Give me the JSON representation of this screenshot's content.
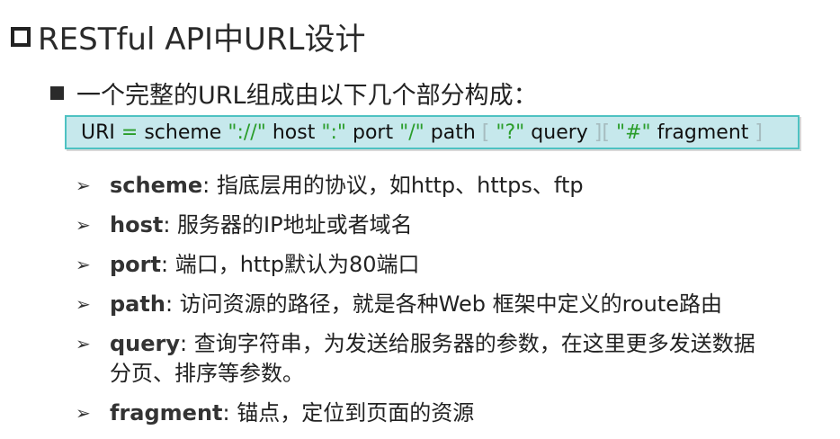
{
  "title": "RESTful API中URL设计",
  "subtitle": "一个完整的URL组成由以下几个部分构成：",
  "url_grammar": {
    "uri": "URI",
    "eq": "=",
    "scheme": "scheme",
    "sep1": "\"://\"",
    "host": "host",
    "sep2": "\":\"",
    "port": "port",
    "sep3": "\"/\"",
    "path": "path",
    "open1": "[",
    "q": "\"?\"",
    "query": "query",
    "close_open": "][",
    "hash": "\"#\"",
    "fragment": "fragment",
    "close2": "]"
  },
  "items": [
    {
      "term": "scheme",
      "desc": ": 指底层用的协议，如http、https、ftp"
    },
    {
      "term": "host",
      "desc": ": 服务器的IP地址或者域名"
    },
    {
      "term": "port",
      "desc": ": 端口，http默认为80端口"
    },
    {
      "term": "path",
      "desc": ": 访问资源的路径，就是各种Web 框架中定义的route路由"
    },
    {
      "term": "query",
      "desc": ": 查询字符串，为发送给服务器的参数，在这里更多发送数据分页、排序等参数。"
    },
    {
      "term": "fragment",
      "desc": ": 锚点，定位到页面的资源"
    }
  ],
  "colors": {
    "url_box_bg": "#c6e8ec",
    "url_box_border": "#4ec2c2",
    "literal": "#2a9d2a",
    "bracket": "#a6bcbf"
  }
}
